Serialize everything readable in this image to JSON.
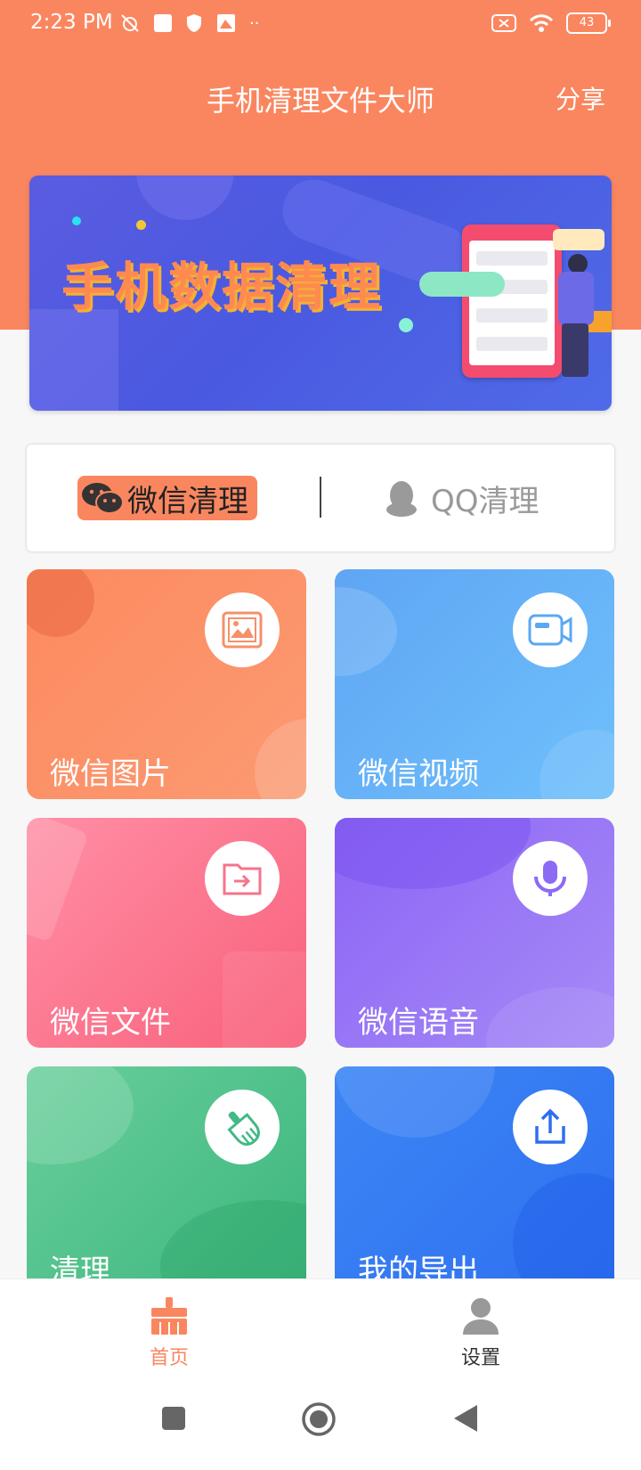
{
  "status_bar": {
    "time": "2:23 PM",
    "battery": "43"
  },
  "header": {
    "title": "手机清理文件大师",
    "share_label": "分享"
  },
  "banner": {
    "title": "手机数据清理"
  },
  "tabs": [
    {
      "label": "微信清理",
      "selected": true
    },
    {
      "label": "QQ清理",
      "selected": false
    }
  ],
  "tiles": [
    {
      "label": "微信图片",
      "icon": "image-icon"
    },
    {
      "label": "微信视频",
      "icon": "video-icon"
    },
    {
      "label": "微信文件",
      "icon": "file-icon"
    },
    {
      "label": "微信语音",
      "icon": "microphone-icon"
    },
    {
      "label": "清理",
      "icon": "broom-icon"
    },
    {
      "label": "我的导出",
      "icon": "share-export-icon"
    }
  ],
  "bottom_nav": [
    {
      "label": "首页",
      "active": true,
      "color": "#fa8660"
    },
    {
      "label": "设置",
      "active": false,
      "color": "#333333"
    }
  ],
  "colors": {
    "accent": "#fa8660"
  }
}
